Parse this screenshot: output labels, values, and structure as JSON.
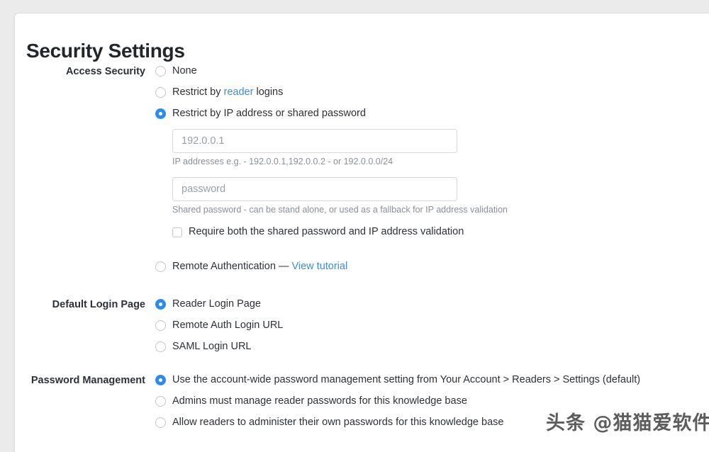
{
  "page": {
    "title": "Security Settings"
  },
  "access_security": {
    "label": "Access Security",
    "options": [
      {
        "id": "none",
        "label": "None",
        "selected": false
      },
      {
        "id": "reader-logins",
        "label_before": "Restrict by ",
        "link": "reader",
        "label_after": " logins",
        "selected": false
      },
      {
        "id": "ip-or-password",
        "label": "Restrict by IP address or shared password",
        "selected": true
      },
      {
        "id": "remote-auth",
        "label_before": "Remote Authentication — ",
        "link": "View tutorial",
        "selected": false
      }
    ],
    "ip_field": {
      "placeholder": "192.0.0.1",
      "value": "",
      "help": "IP addresses e.g. - 192.0.0.1,192.0.0.2 - or 192.0.0.0/24"
    },
    "password_field": {
      "placeholder": "password",
      "value": "",
      "help": "Shared password - can be stand alone, or used as a fallback for IP address validation"
    },
    "require_both": {
      "label": "Require both the shared password and IP address validation",
      "checked": false
    }
  },
  "default_login_page": {
    "label": "Default Login Page",
    "options": [
      {
        "id": "reader-login-page",
        "label": "Reader Login Page",
        "selected": true
      },
      {
        "id": "remote-auth-login-url",
        "label": "Remote Auth Login URL",
        "selected": false
      },
      {
        "id": "saml-login-url",
        "label": "SAML Login URL",
        "selected": false
      }
    ]
  },
  "password_management": {
    "label": "Password Management",
    "options": [
      {
        "id": "account-wide",
        "label": "Use the account-wide password management setting from Your Account > Readers > Settings (default)",
        "selected": true
      },
      {
        "id": "admins-manage",
        "label": "Admins must manage reader passwords for this knowledge base",
        "selected": false
      },
      {
        "id": "readers-self",
        "label": "Allow readers to administer their own passwords for this knowledge base",
        "selected": false
      }
    ]
  },
  "watermark": {
    "text": "头条 @猫猫爱软件"
  },
  "colors": {
    "accent": "#2b8bf0",
    "link": "#3d8dd8",
    "text": "#2d3136",
    "muted": "#8a9097",
    "page_bg": "#ebebeb",
    "card_bg": "#ffffff"
  }
}
